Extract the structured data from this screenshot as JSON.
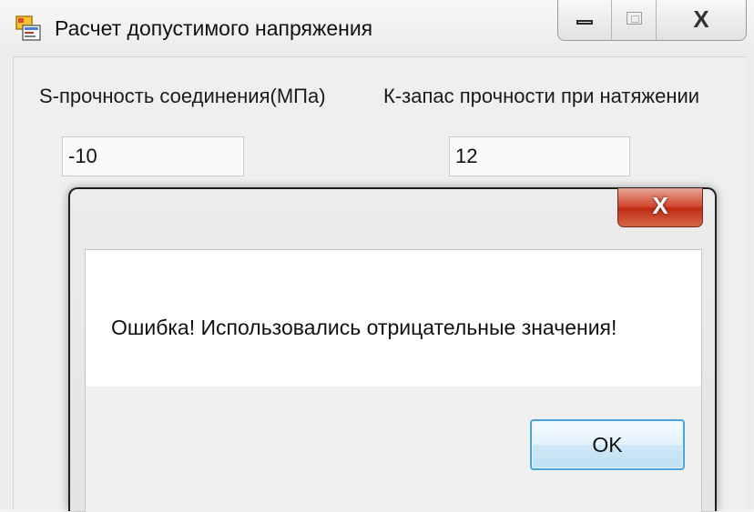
{
  "main_window": {
    "title": "Расчет допустимого напряжения",
    "icon": "app-form-icon",
    "caption_buttons": {
      "minimize_icon": "minimize-icon",
      "maximize_icon": "maximize-icon",
      "close_icon": "close-icon",
      "close_glyph": "X"
    }
  },
  "form": {
    "strength_label": "S-прочность соединения(МПа)",
    "strength_value": "-10",
    "safety_label": "К-запас прочности при натяжении",
    "safety_value": "12"
  },
  "message_box": {
    "close_glyph": "X",
    "message": "Ошибка! Использовались отрицательные значения!",
    "ok_label": "OK"
  },
  "colors": {
    "close_button_red": "#c9381f",
    "ok_button_border": "#4aa3d9",
    "window_background": "#efefef"
  }
}
